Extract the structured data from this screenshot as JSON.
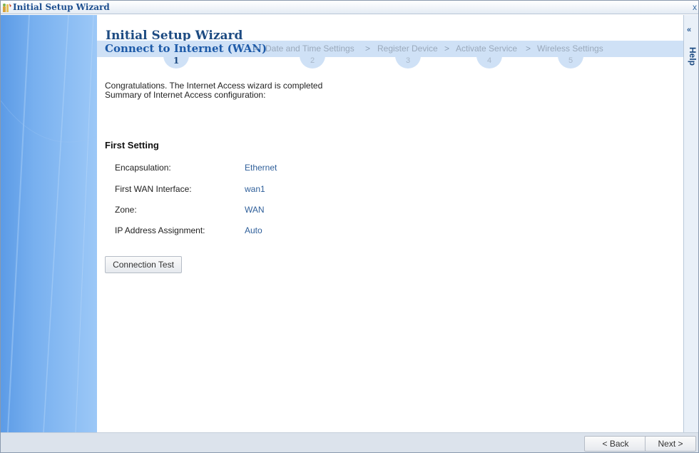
{
  "window": {
    "title": "Initial Setup Wizard",
    "close_label": "x"
  },
  "wizard": {
    "title": "Initial Setup Wizard",
    "steps": [
      {
        "label": "Connect to Internet (WAN)",
        "number": "1",
        "active": true
      },
      {
        "label": "Date and Time Settings",
        "number": "2",
        "active": false
      },
      {
        "label": "Register Device",
        "number": "3",
        "active": false
      },
      {
        "label": "Activate Service",
        "number": "4",
        "active": false
      },
      {
        "label": "Wireless Settings",
        "number": "5",
        "active": false
      }
    ],
    "separator": ">"
  },
  "main": {
    "message_line1": "Congratulations. The Internet Access wizard is completed",
    "message_line2": "Summary of Internet Access configuration:",
    "section_title": "First Setting",
    "settings": [
      {
        "label": "Encapsulation:",
        "value": "Ethernet"
      },
      {
        "label": "First WAN Interface:",
        "value": "wan1"
      },
      {
        "label": "Zone:",
        "value": "WAN"
      },
      {
        "label": "IP Address Assignment:",
        "value": "Auto"
      }
    ],
    "connection_test_label": "Connection Test"
  },
  "help": {
    "collapse_label": "«",
    "label": "Help"
  },
  "footer": {
    "back_label": "< Back",
    "next_label": "Next >"
  },
  "colors": {
    "accent": "#1d4b82",
    "step_bar": "#cfe1f6",
    "side_panel": "#78b0ef"
  }
}
